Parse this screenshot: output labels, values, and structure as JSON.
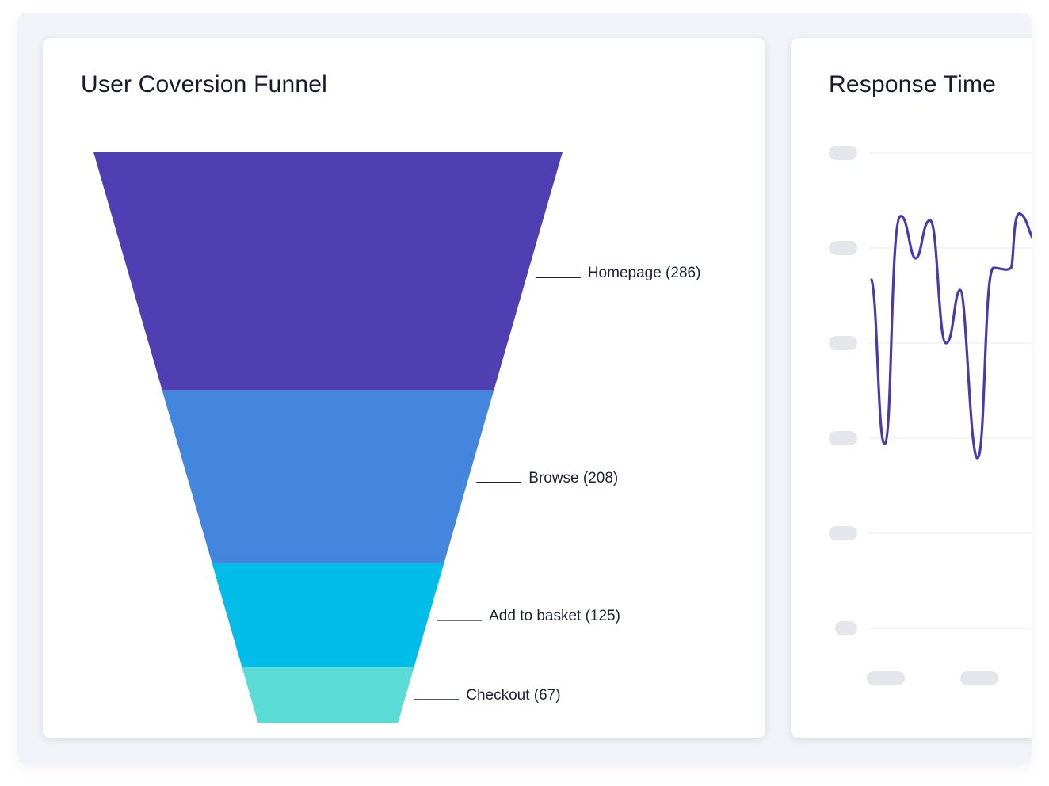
{
  "funnel_card": {
    "title": "User Coversion Funnel"
  },
  "response_card": {
    "title": "Response Time"
  },
  "colors": {
    "stage1": "#4f3fb3",
    "stage2": "#4486de",
    "stage3": "#00bce9",
    "stage4": "#5adbd6",
    "line": "#4a3aad",
    "placeholder": "#e5e6eb",
    "gridline": "#eef0f4"
  },
  "chart_data": [
    {
      "type": "funnel",
      "title": "User Coversion Funnel",
      "stages": [
        {
          "label": "Homepage (286)",
          "name": "Homepage",
          "value": 286
        },
        {
          "label": "Browse (208)",
          "name": "Browse",
          "value": 208
        },
        {
          "label": "Add to basket (125)",
          "name": "Add to basket",
          "value": 125
        },
        {
          "label": "Checkout (67)",
          "name": "Checkout",
          "value": 67
        }
      ]
    },
    {
      "type": "line",
      "title": "Response Time",
      "grid": true,
      "tick_labels_visible": false,
      "gridline_count": 6,
      "x_tick_count": 2
    }
  ]
}
